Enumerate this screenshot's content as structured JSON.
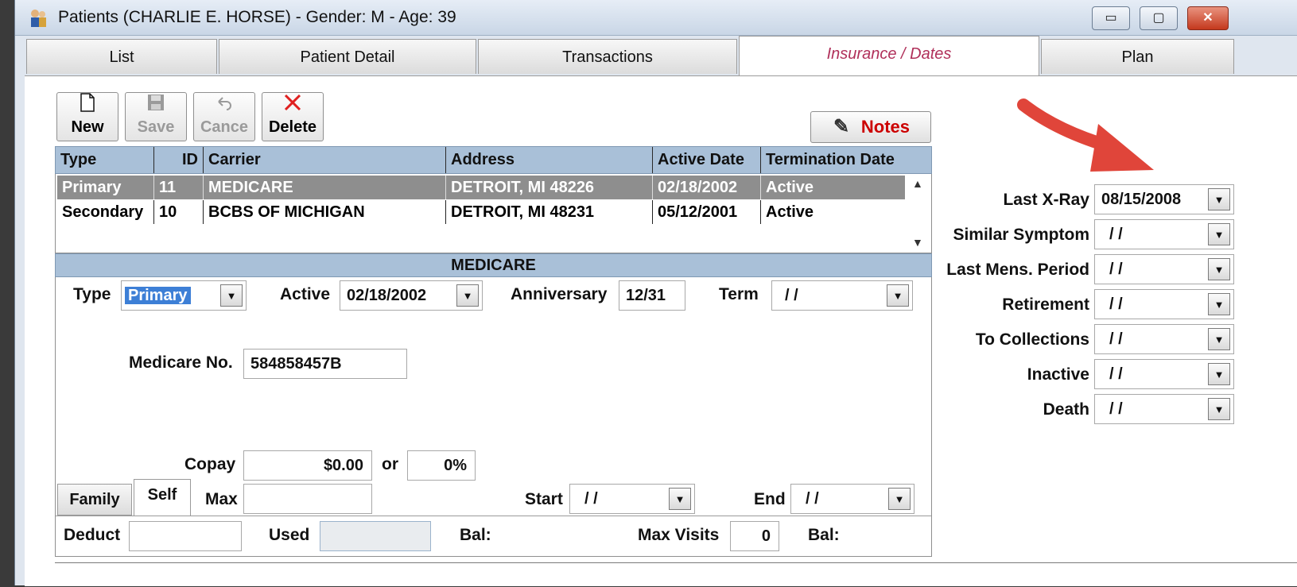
{
  "window": {
    "title": "Patients (CHARLIE E. HORSE) - Gender: M - Age: 39",
    "minimize_glyph": "▭",
    "maximize_glyph": "▢",
    "close_glyph": "✕"
  },
  "tabs": [
    {
      "label": "List"
    },
    {
      "label": "Patient Detail"
    },
    {
      "label": "Transactions"
    },
    {
      "label": "Insurance / Dates",
      "active": true
    },
    {
      "label": "Plan"
    }
  ],
  "toolbar": {
    "new_label": "New",
    "save_label": "Save",
    "cancel_label": "Cance",
    "delete_label": "Delete",
    "notes_label": "Notes"
  },
  "insurance_grid": {
    "columns": [
      "Type",
      "ID",
      "Carrier",
      "Address",
      "Active Date",
      "Termination Date"
    ],
    "rows": [
      {
        "type": "Primary",
        "id": "11",
        "carrier": "MEDICARE",
        "address": "DETROIT, MI 48226",
        "active_date": "02/18/2002",
        "termination": "Active",
        "selected": true
      },
      {
        "type": "Secondary",
        "id": "10",
        "carrier": "BCBS OF MICHIGAN",
        "address": "DETROIT, MI 48231",
        "active_date": "05/12/2001",
        "termination": "Active",
        "selected": false
      }
    ]
  },
  "detail": {
    "section_title": "MEDICARE",
    "type_label": "Type",
    "type_value": "Primary",
    "active_label": "Active",
    "active_value": "02/18/2002",
    "anniversary_label": "Anniversary",
    "anniversary_value": "12/31",
    "term_label": "Term",
    "term_value": "/ /",
    "medicare_no_label": "Medicare No.",
    "medicare_no_value": "584858457B",
    "copay_label": "Copay",
    "copay_value": "$0.00",
    "or_label": "or",
    "copay_pct": "0%",
    "family_tab": "Family",
    "self_tab": "Self",
    "max_label": "Max",
    "max_value": "",
    "start_label": "Start",
    "start_value": "/ /",
    "end_label": "End",
    "end_value": "/ /",
    "deduct_label": "Deduct",
    "deduct_value": "",
    "used_label": "Used",
    "used_value": "",
    "bal_label": "Bal:",
    "max_visits_label": "Max Visits",
    "max_visits_value": "0",
    "bal2_label": "Bal:"
  },
  "dates": [
    {
      "label": "Last X-Ray",
      "value": "08/15/2008"
    },
    {
      "label": "Similar Symptom",
      "value": "/ /"
    },
    {
      "label": "Last Mens. Period",
      "value": "/ /"
    },
    {
      "label": "Retirement",
      "value": "/ /"
    },
    {
      "label": "To Collections",
      "value": "/ /"
    },
    {
      "label": "Inactive",
      "value": "/ /"
    },
    {
      "label": "Death",
      "value": "/ /"
    }
  ],
  "colors": {
    "accent_arrow": "#e0453a",
    "grid_header": "#a9c0d8",
    "selected_row": "#8e8e8e",
    "active_tab_text": "#b0305a",
    "notes_text": "#cc0000"
  },
  "icons": {
    "app": "patients-app-icon",
    "new": "new-document-icon",
    "save": "floppy-disk-icon",
    "cancel": "undo-icon",
    "delete": "red-x-icon",
    "notes": "notes-pen-icon",
    "dropdown": "chevron-down-icon"
  }
}
